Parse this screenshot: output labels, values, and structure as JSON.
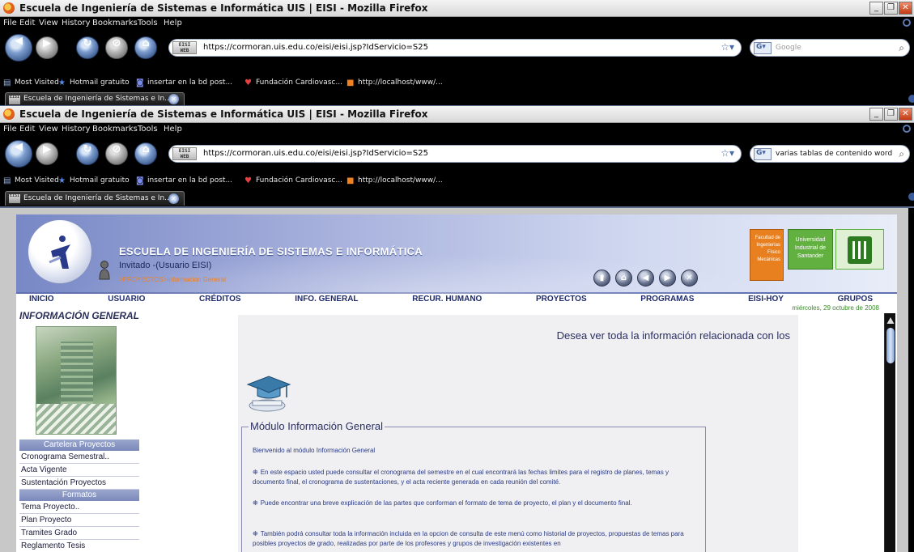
{
  "window1": {
    "title": "Escuela de Ingeniería de Sistemas e Informática UIS | EISI - Mozilla Firefox",
    "menu": [
      "File",
      "Edit",
      "View",
      "History",
      "Bookmarks",
      "Tools",
      "Help"
    ],
    "url": "https://cormoran.uis.edu.co/eisi/eisi.jsp?IdServicio=S25",
    "search_placeholder": "Google",
    "bookmarks": [
      "Most Visited",
      "Hotmail gratuito",
      "insertar en la bd post...",
      "Fundación Cardiovasc...",
      "http://localhost/www/..."
    ],
    "tab_label": "Escuela de Ingeniería de Sistemas e In..."
  },
  "window2": {
    "title": "Escuela de Ingeniería de Sistemas e Informática UIS | EISI - Mozilla Firefox",
    "menu": [
      "File",
      "Edit",
      "View",
      "History",
      "Bookmarks",
      "Tools",
      "Help"
    ],
    "url": "https://cormoran.uis.edu.co/eisi/eisi.jsp?IdServicio=S25",
    "search_value": "varias tablas de contenido word",
    "bookmarks": [
      "Most Visited",
      "Hotmail gratuito",
      "insertar en la bd post...",
      "Fundación Cardiovasc...",
      "http://localhost/www/..."
    ],
    "tab_label": "Escuela de Ingeniería de Sistemas e In..."
  },
  "site_badge": "EISI WEB",
  "header": {
    "school_name": "ESCUELA DE INGENIERÍA DE SISTEMAS E INFORMÁTICA",
    "user": "Invitado -(Usuario EISI)",
    "breadcrumb": ">PROYECTOS>Información General",
    "faculty": "Facultad de Ingenierías Físico Mecánicas",
    "university": "Universidad Industrial de Santander"
  },
  "menu": [
    "INICIO",
    "USUARIO",
    "CRÉDITOS",
    "INFO. GENERAL",
    "RECUR. HUMANO",
    "PROYECTOS",
    "PROGRAMAS",
    "EISI-HOY",
    "GRUPOS"
  ],
  "date": "miércoles, 29 octubre de 2008",
  "sidebar": {
    "title": "INFORMACIÓN GENERAL",
    "section1": "Cartelera Proyectos",
    "items1": [
      "Cronograma Semestral..",
      "Acta Vigente",
      "Sustentación Proyectos"
    ],
    "section2": "Formatos",
    "items2": [
      "Tema Proyecto..",
      "Plan Proyecto",
      "Tramites Grado",
      "Reglamento Tesis"
    ]
  },
  "main": {
    "banner": "Desea ver toda la información relacionada con los",
    "module_title": "Módulo Información General",
    "welcome": "Bienvenido al módulo Información General",
    "para1": "En este espacio usted puede consultar el cronograma del semestre en el cual encontrará las fechas limites para el registro de planes, temas y documento final, el cronograma de sustentaciones, y el acta reciente generada en cada reunión del comité.",
    "para2": "Puede encontrar una breve explicación de las partes que conforman el formato de tema de proyecto, el plan y el documento final.",
    "para3": "También podrá consultar toda la información incluida en la opcion de consulta de este menú como historial de proyectos, propuestas de temas para posibles proyectos de grado, realizadas por parte de los profesores y grupos de investigación existentes en"
  },
  "colors": {
    "header_blue": "#7888c6",
    "menu_text": "#1e2a6a",
    "breadcrumb_orange": "#f08020",
    "date_green": "#3a8a2a",
    "faculty_orange": "#e88020",
    "univ_green": "#62b040"
  }
}
